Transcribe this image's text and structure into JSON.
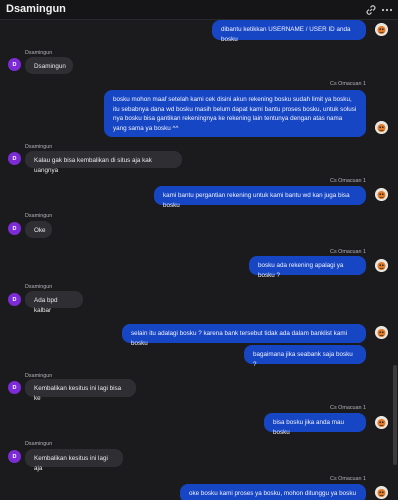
{
  "header": {
    "title": "Dsamingun",
    "link_icon": "link-icon",
    "more_icon": "more-icon"
  },
  "agent": {
    "name": "Cs Omacuan 1"
  },
  "visitor": {
    "name": "Dsamingun",
    "initial": "D"
  },
  "colors": {
    "out_bubble": "#1746c4",
    "in_bubble": "#2e2e33",
    "visitor_avatar": "#7c2bd6",
    "background": "#1b1b1e"
  },
  "hash_marker": "#",
  "messages": [
    {
      "from": "agent",
      "text": "dibantu ketikkan USERNAME / USER ID anda bosku"
    },
    {
      "from": "visitor",
      "text": "Dsamingun"
    },
    {
      "from": "agent",
      "text": "bosku mohon maaf setelah kami cek disini akun rekening bosku sudah limit ya bosku, itu sebabnya dana wd bosku masih belum dapat kami bantu proses bosku, untuk solusi nya bosku bisa gantikan rekeningnya ke rekening lain tentunya dengan atas nama yang sama ya bosku ^^"
    },
    {
      "from": "visitor",
      "text": "Kalau gak bisa kembalikan di situs aja kak uangnya"
    },
    {
      "from": "agent",
      "text": "kami bantu pergantian rekening untuk kami bantu wd kan juga bisa bosku"
    },
    {
      "from": "visitor",
      "text": "Oke"
    },
    {
      "from": "agent",
      "text": "bosku ada rekening apalagi ya bosku ?"
    },
    {
      "from": "visitor",
      "text": "Ada bpd kalbar"
    },
    {
      "from": "agent",
      "text": "selain itu adalagi bosku ? karena bank tersebut tidak ada dalam banklist kami bosku"
    },
    {
      "from": "agent",
      "text": "bagaimana jika seabank saja bosku ?"
    },
    {
      "from": "visitor",
      "text": "Kembalikan kesitus ini lagi bisa ke"
    },
    {
      "from": "agent",
      "text": "bisa bosku jika anda mau bosku"
    },
    {
      "from": "visitor",
      "text": "Kembalikan kesitus ini lagi aja"
    },
    {
      "from": "agent",
      "text": "oke bosku kami proses ya bosku, mohon ditunggu ya bosku ^^"
    }
  ]
}
